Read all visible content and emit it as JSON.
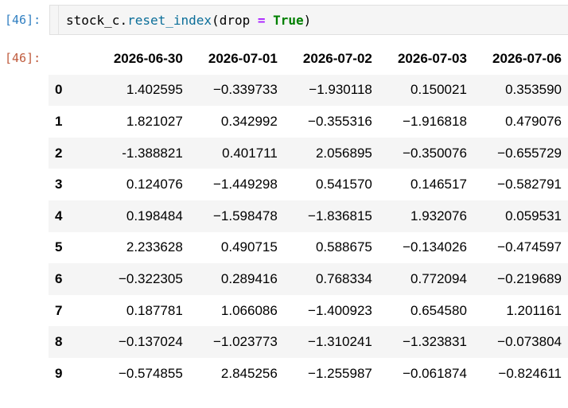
{
  "input_prompt": "[46]:",
  "output_prompt": "[46]:",
  "code": {
    "var": "stock_c",
    "dot": ".",
    "method": "reset_index",
    "open": "(",
    "arg": "drop ",
    "op": "=",
    "space": " ",
    "value": "True",
    "close": ")"
  },
  "table": {
    "columns": [
      "2026-06-30",
      "2026-07-01",
      "2026-07-02",
      "2026-07-03",
      "2026-07-06"
    ],
    "rows": [
      {
        "index": "0",
        "values": [
          "1.402595",
          "−0.339733",
          "−1.930118",
          "0.150021",
          "0.353590"
        ]
      },
      {
        "index": "1",
        "values": [
          "1.821027",
          "0.342992",
          "−0.355316",
          "−1.916818",
          "0.479076"
        ]
      },
      {
        "index": "2",
        "values": [
          "-1.388821",
          "0.401711",
          "2.056895",
          "−0.350076",
          "−0.655729"
        ]
      },
      {
        "index": "3",
        "values": [
          "0.124076",
          "−1.449298",
          "0.541570",
          "0.146517",
          "−0.582791"
        ]
      },
      {
        "index": "4",
        "values": [
          "0.198484",
          "−1.598478",
          "−1.836815",
          "1.932076",
          "0.059531"
        ]
      },
      {
        "index": "5",
        "values": [
          "2.233628",
          "0.490715",
          "0.588675",
          "−0.134026",
          "−0.474597"
        ]
      },
      {
        "index": "6",
        "values": [
          "−0.322305",
          "0.289416",
          "0.768334",
          "0.772094",
          "−0.219689"
        ]
      },
      {
        "index": "7",
        "values": [
          "0.187781",
          "1.066086",
          "−1.400923",
          "0.654580",
          "1.201161"
        ]
      },
      {
        "index": "8",
        "values": [
          "−0.137024",
          "−1.023773",
          "−1.310241",
          "−1.323831",
          "−0.073804"
        ]
      },
      {
        "index": "9",
        "values": [
          "−0.574855",
          "2.845256",
          "−1.255987",
          "−0.061874",
          "−0.824611"
        ]
      }
    ]
  }
}
